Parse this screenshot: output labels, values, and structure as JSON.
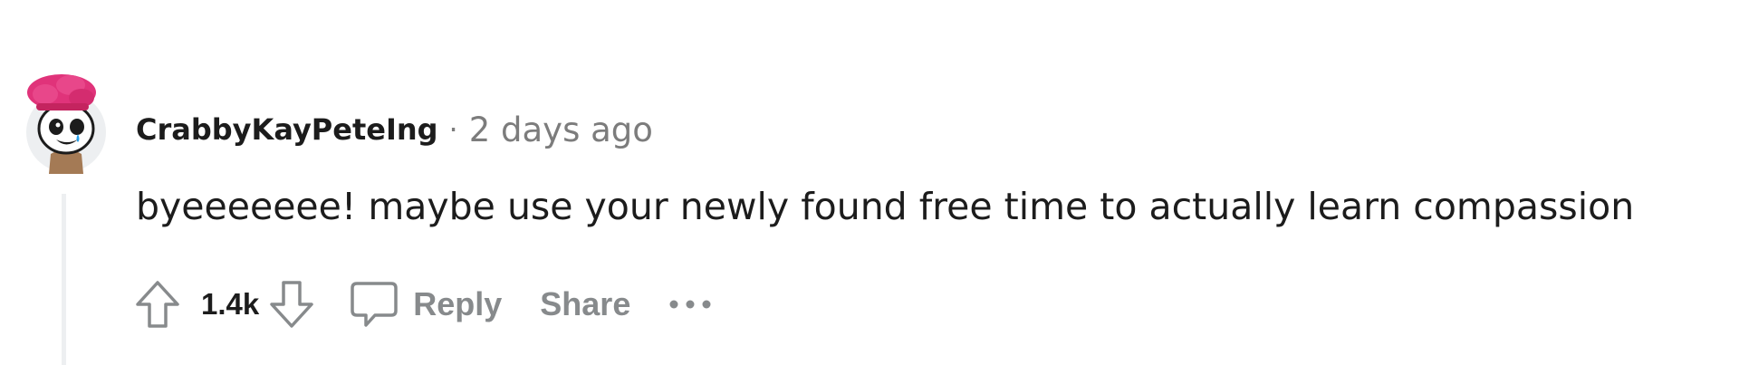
{
  "comment": {
    "author": "CrabbyKayPeteIng",
    "separator": "·",
    "timestamp": "2 days ago",
    "body": "byeeeeeee! maybe use your newly found free time to actually learn compassion",
    "votes": "1.4k",
    "actions": {
      "reply_label": "Reply",
      "share_label": "Share"
    },
    "icons": {
      "avatar": "snoo-avatar",
      "upvote": "upvote-arrow-icon",
      "downvote": "downvote-arrow-icon",
      "reply": "speech-bubble-icon",
      "more": "ellipsis-icon"
    },
    "colors": {
      "avatar_hat": "#e0337a",
      "text": "#1c1c1c",
      "muted": "#878a8c",
      "thread_line": "#edeff1"
    }
  }
}
